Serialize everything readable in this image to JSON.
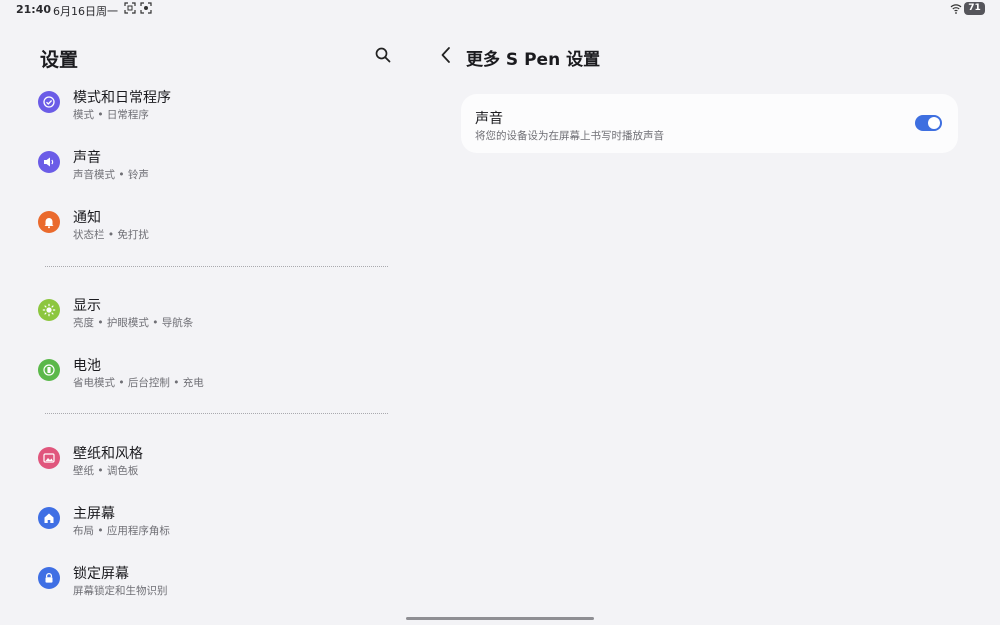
{
  "status_bar": {
    "time": "21:40",
    "date": "6月16日周一",
    "battery": "71"
  },
  "left_panel": {
    "title": "设置",
    "items": [
      {
        "label": "模式和日常程序",
        "sub": "模式 • 日常程序",
        "icon": "routine-check-icon",
        "color": "#6b5ce7"
      },
      {
        "label": "声音",
        "sub": "声音模式 • 铃声",
        "icon": "speaker-icon",
        "color": "#6b5ce7"
      },
      {
        "label": "通知",
        "sub": "状态栏 • 免打扰",
        "icon": "bell-icon",
        "color": "#ea6a2d"
      },
      {
        "label": "显示",
        "sub": "亮度 • 护眼模式 • 导航条",
        "icon": "sun-icon",
        "color": "#8cc63f"
      },
      {
        "label": "电池",
        "sub": "省电模式 • 后台控制 • 充电",
        "icon": "battery-icon",
        "color": "#5bb84a"
      },
      {
        "label": "壁纸和风格",
        "sub": "壁纸 • 调色板",
        "icon": "image-icon",
        "color": "#e0567d"
      },
      {
        "label": "主屏幕",
        "sub": "布局 • 应用程序角标",
        "icon": "home-icon",
        "color": "#3f6fe4"
      },
      {
        "label": "锁定屏幕",
        "sub": "屏幕锁定和生物识别",
        "icon": "lock-icon",
        "color": "#3f6fe4"
      }
    ]
  },
  "right_panel": {
    "title": "更多 S Pen 设置",
    "setting": {
      "label": "声音",
      "description": "将您的设备设为在屏幕上书写时播放声音",
      "enabled": true
    }
  },
  "colors": {
    "background": "#f3f3f6",
    "card": "#fcfcfd",
    "accent": "#3e6fe0"
  }
}
